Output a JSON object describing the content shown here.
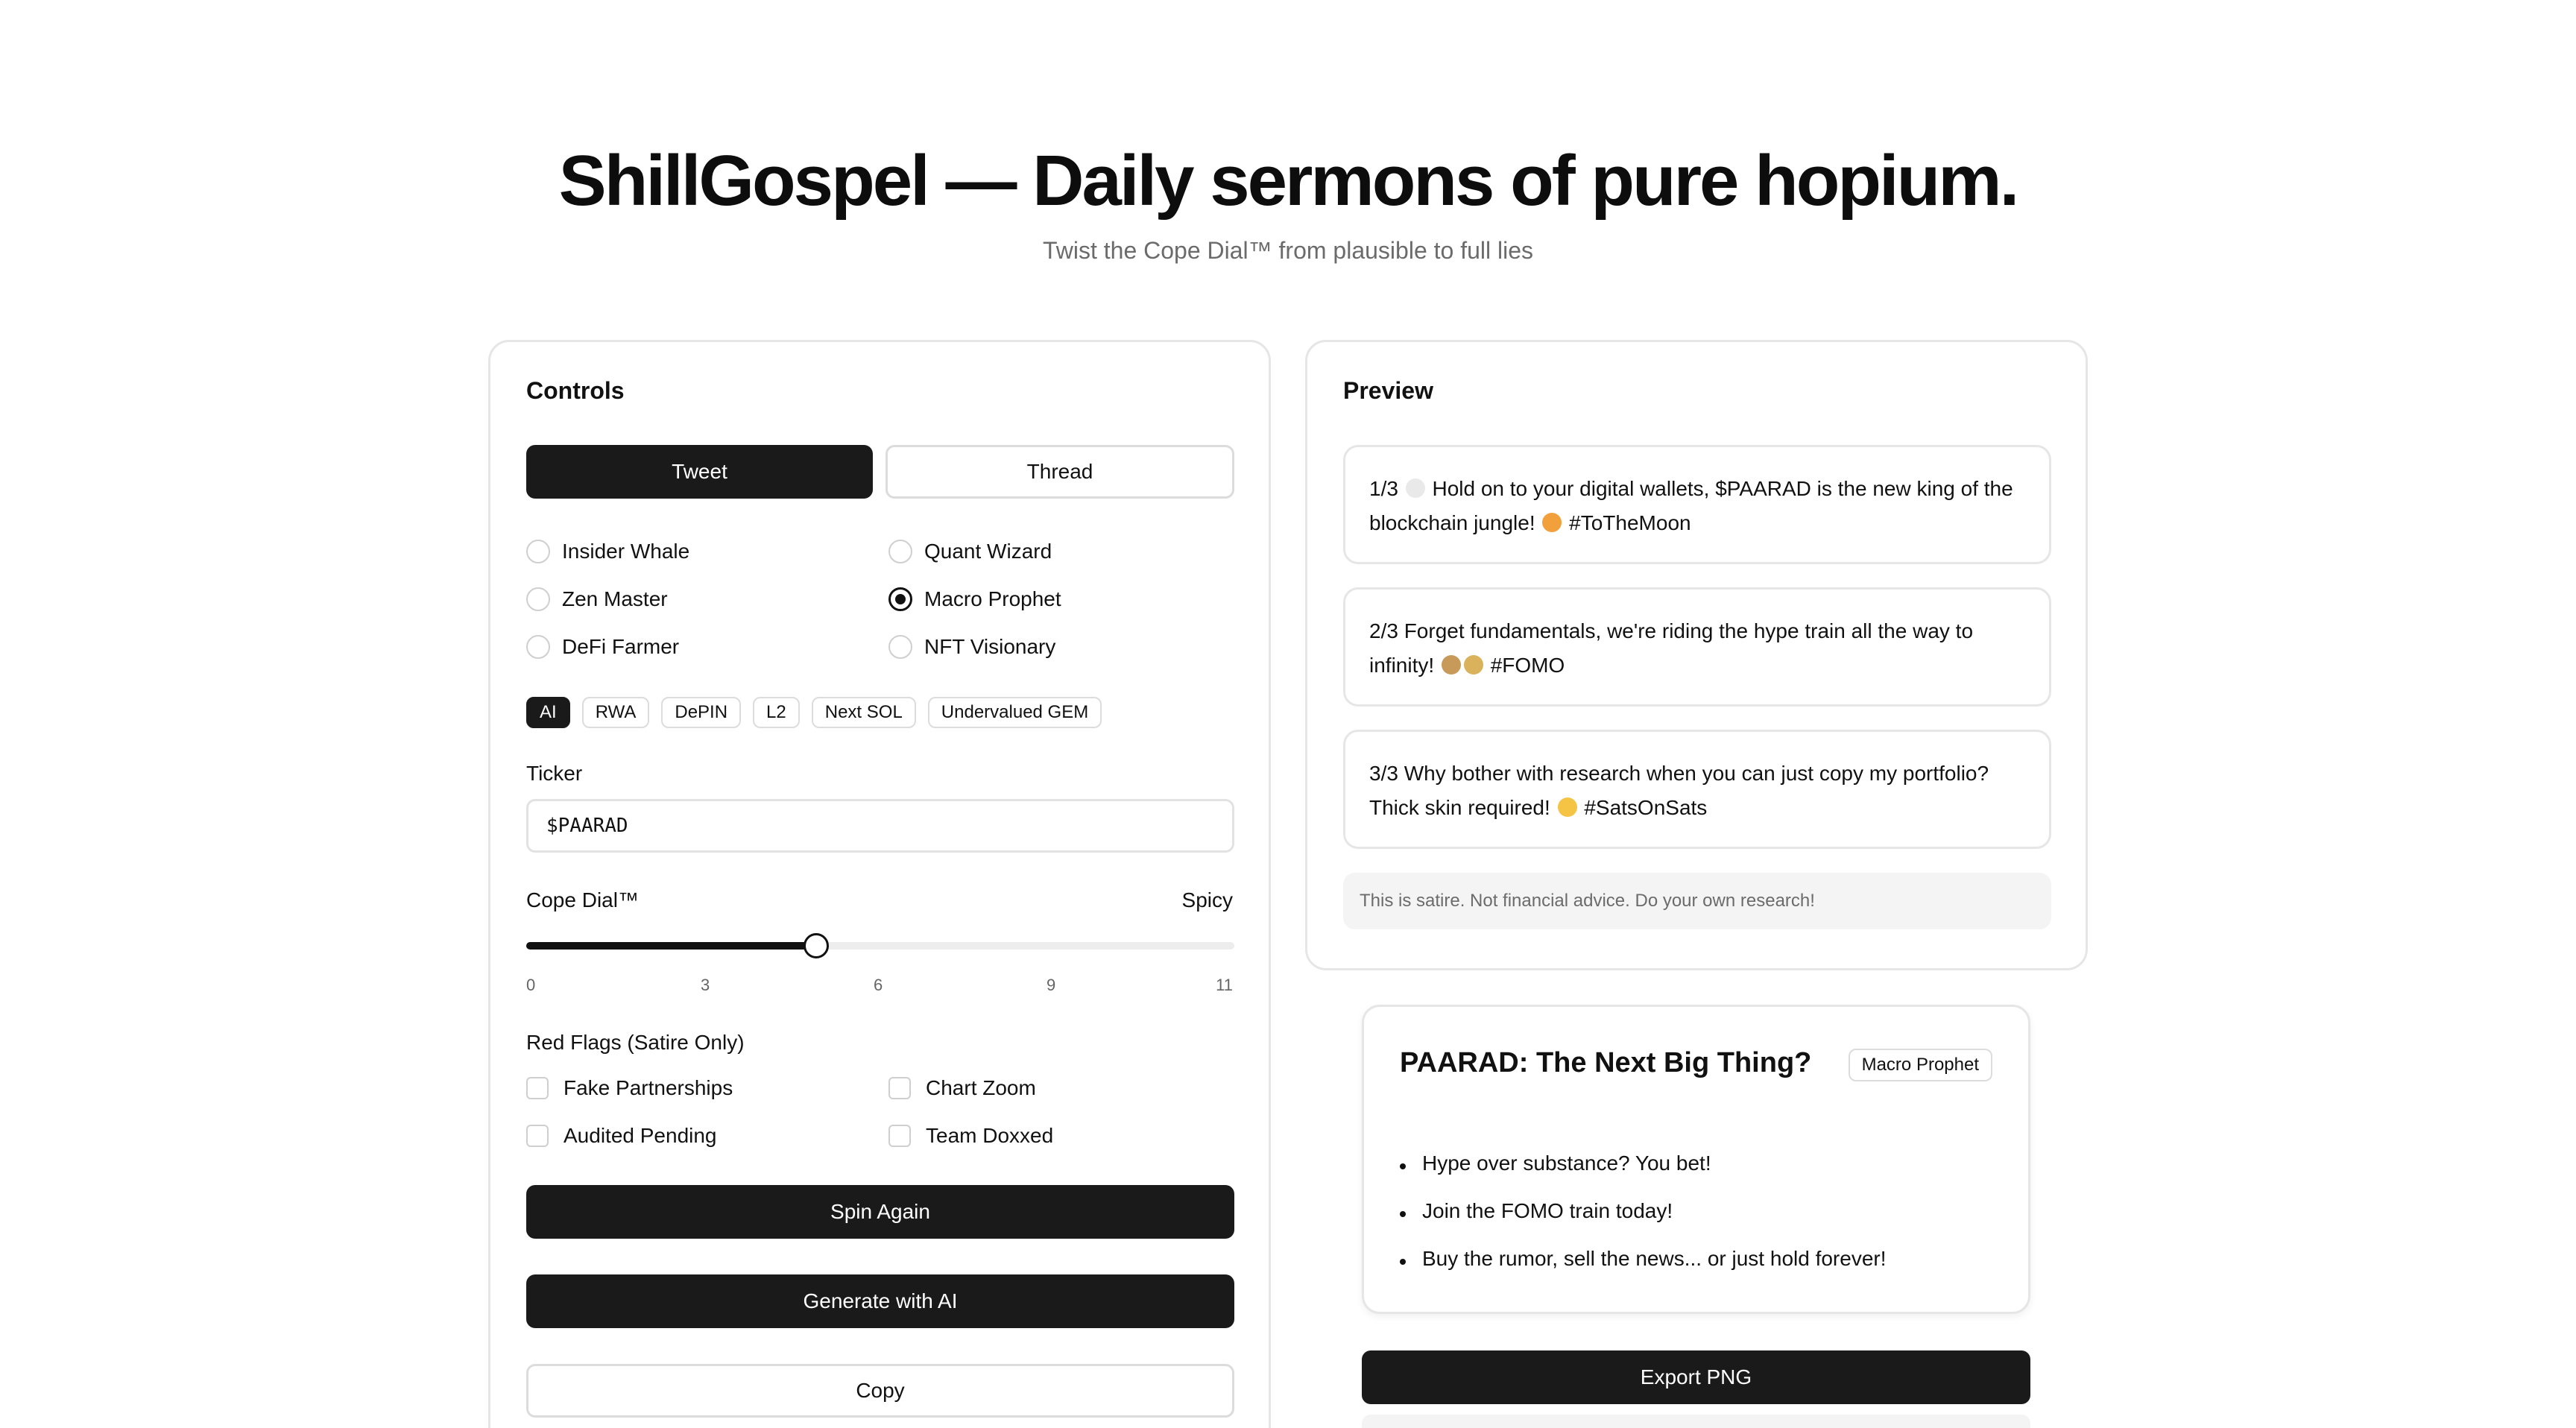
{
  "header": {
    "title": "ShillGospel — Daily sermons of pure hopium.",
    "subtitle": "Twist the Cope Dial™ from plausible to full lies"
  },
  "controls": {
    "title": "Controls",
    "modes": [
      {
        "label": "Tweet",
        "active": true
      },
      {
        "label": "Thread",
        "active": false
      }
    ],
    "personas": [
      {
        "label": "Insider Whale",
        "checked": false
      },
      {
        "label": "Quant Wizard",
        "checked": false
      },
      {
        "label": "Zen Master",
        "checked": false
      },
      {
        "label": "Macro Prophet",
        "checked": true
      },
      {
        "label": "DeFi Farmer",
        "checked": false
      },
      {
        "label": "NFT Visionary",
        "checked": false
      }
    ],
    "narratives": [
      {
        "label": "AI",
        "active": true
      },
      {
        "label": "RWA",
        "active": false
      },
      {
        "label": "DePIN",
        "active": false
      },
      {
        "label": "L2",
        "active": false
      },
      {
        "label": "Next SOL",
        "active": false
      },
      {
        "label": "Undervalued GEM",
        "active": false
      }
    ],
    "ticker_label": "Ticker",
    "ticker_value": "$PAARAD",
    "cope_label": "Cope Dial™",
    "cope_level_label": "Spicy",
    "cope_value": 4.5,
    "cope_min": 0,
    "cope_max": 11,
    "cope_ticks": [
      "0",
      "3",
      "6",
      "9",
      "11"
    ],
    "red_flags_label": "Red Flags (Satire Only)",
    "red_flags": [
      {
        "label": "Fake Partnerships",
        "checked": false
      },
      {
        "label": "Chart Zoom",
        "checked": false
      },
      {
        "label": "Audited Pending",
        "checked": false
      },
      {
        "label": "Team Doxxed",
        "checked": false
      }
    ],
    "spin_label": "Spin Again",
    "generate_label": "Generate with AI",
    "copy_label": "Copy"
  },
  "preview": {
    "title": "Preview",
    "tweets": [
      {
        "pre": "1/3 ",
        "emoji1": "rocket",
        "text": " Hold on to your digital wallets, $PAARAD is the new king of the blockchain jungle! ",
        "emoji2": "lion",
        "post": " #ToTheMoon"
      },
      {
        "pre": "2/3 Forget fundamentals, we're riding the hype train all the way to infinity! ",
        "emoji1": "train",
        "text": "",
        "emoji2": "money-bag",
        "post": " #FOMO"
      },
      {
        "pre": "3/3 Why bother with research when you can just copy my portfolio? Thick skin required! ",
        "emoji1": "laughing",
        "text": "",
        "emoji2": "",
        "post": " #SatsOnSats"
      }
    ],
    "disclaimer": "This is satire. Not financial advice. Do your own research!"
  },
  "share_card": {
    "title": "PAARAD: The Next Big Thing?",
    "badge": "Macro Prophet",
    "bullets": [
      "Hype over substance? You bet!",
      "Join the FOMO train today!",
      "Buy the rumor, sell the news... or just hold forever!"
    ],
    "export_label": "Export PNG"
  }
}
